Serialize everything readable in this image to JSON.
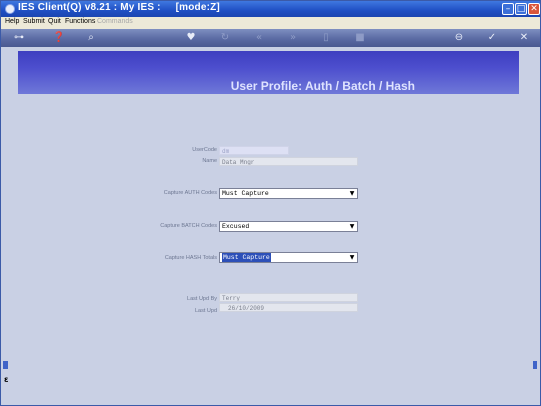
{
  "window": {
    "title": "IES Client(Q) v8.21 : My IES :     [mode:Z]"
  },
  "menu": {
    "items": [
      "Help",
      "Submit",
      "Quit",
      "Functions"
    ],
    "disabled_item": "Commands"
  },
  "toolbar": {
    "icons": [
      "key-icon",
      "help-icon",
      "search-icon",
      "heart-icon",
      "refresh-icon",
      "rewind-icon",
      "forward-icon",
      "document-icon",
      "stop-icon",
      "back-icon",
      "confirm-icon",
      "cancel-icon"
    ]
  },
  "header": {
    "title": "User Profile: Auth / Batch / Hash"
  },
  "form": {
    "usercode_label": "UserCode",
    "usercode_value": "dm",
    "name_label": "Name",
    "name_value": "Data Mngr",
    "auth_label": "Capture AUTH Codes",
    "auth_value": "Must Capture",
    "batch_label": "Capture BATCH Codes",
    "batch_value": "Excused",
    "hash_label": "Capture HASH Totals",
    "hash_value": "Must Capture",
    "last_upd_by_label": "Last Upd By",
    "last_upd_by_value": "Terry",
    "last_upd_label": "Last Upd",
    "last_upd_value": "26/10/2009"
  },
  "colors": {
    "titlebar": "#1f4fc4",
    "header_band": "#4d4fce",
    "content_bg": "#c9d0e4",
    "selection": "#2c4fb8"
  }
}
